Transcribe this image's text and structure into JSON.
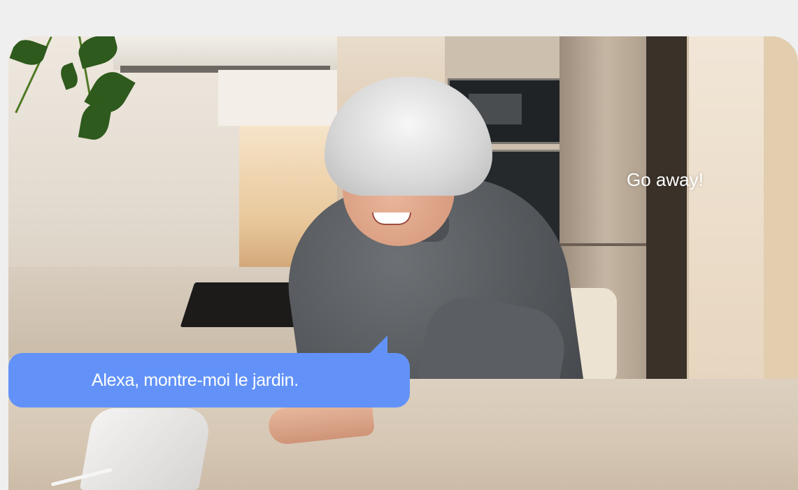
{
  "speech_bubble": {
    "text": "Alexa, montre-moi le jardin."
  },
  "caption": {
    "text": "Go away!"
  },
  "colors": {
    "bubble": "#6292f8",
    "page_background": "#efefef",
    "text": "#ffffff"
  },
  "image": {
    "subject": "kitchen-scene-photo"
  }
}
